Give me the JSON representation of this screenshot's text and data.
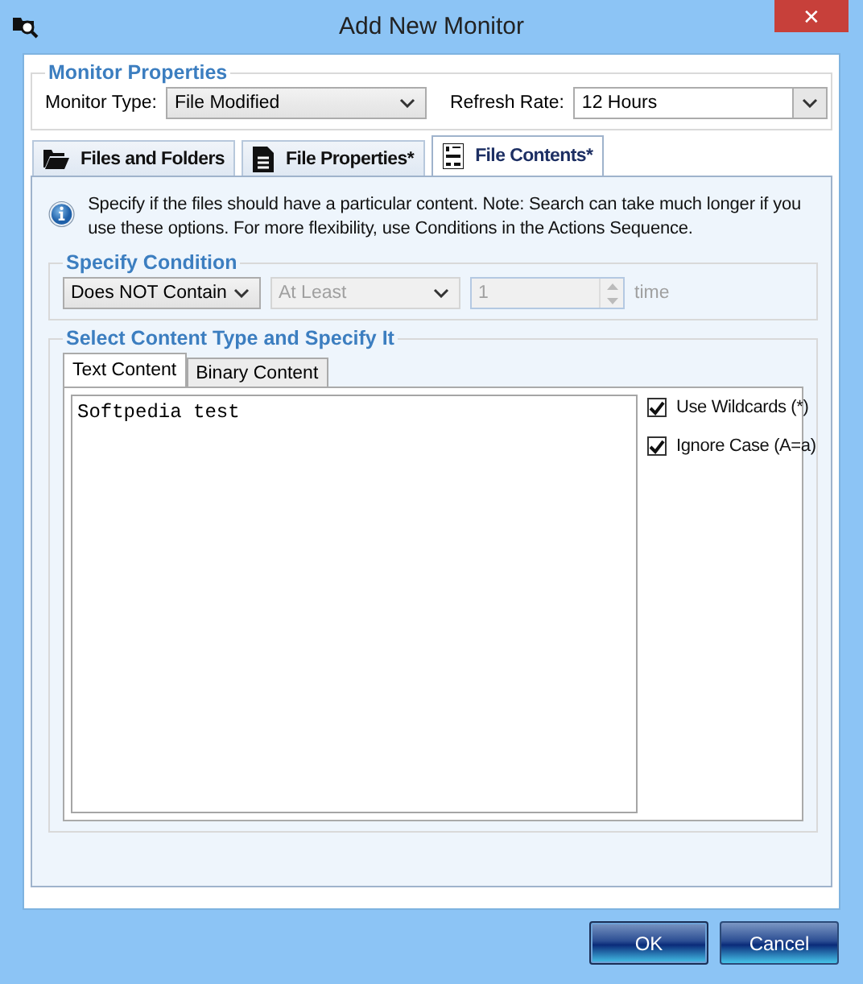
{
  "window": {
    "title": "Add New Monitor",
    "close": "✕"
  },
  "monitor_properties": {
    "title": "Monitor Properties",
    "monitor_type_label": "Monitor Type:",
    "monitor_type": "File Modified",
    "refresh_rate_label": "Refresh Rate:",
    "refresh_rate": "12 Hours"
  },
  "tabs": [
    {
      "label": "Files and Folders",
      "kind": "folder",
      "selected": false
    },
    {
      "label": "File Properties*",
      "kind": "document",
      "selected": false
    },
    {
      "label": "File Contents*",
      "kind": "binary",
      "selected": true
    }
  ],
  "info": "Specify if the files should have a particular content. Note: Search can take much longer if you use these options. For more flexibility, use Conditions in the Actions Sequence.",
  "condition": {
    "title": "Specify Condition",
    "mode": {
      "value": "Does NOT Contain",
      "disabled": false
    },
    "quantifier": {
      "value": "At Least",
      "disabled": true
    },
    "count": {
      "value": "1",
      "disabled": true
    },
    "unit": {
      "text": "time",
      "disabled": true
    }
  },
  "content": {
    "title": "Select Content Type and Specify It",
    "tabs": [
      {
        "label": "Text Content",
        "selected": true
      },
      {
        "label": "Binary Content",
        "selected": false
      }
    ],
    "text": "Softpedia test",
    "options": [
      {
        "label": "Use Wildcards (*)",
        "checked": true
      },
      {
        "label": "Ignore Case (A=a)",
        "checked": true
      }
    ]
  },
  "buttons": [
    {
      "label": "OK",
      "default": true
    },
    {
      "label": "Cancel",
      "default": false
    }
  ]
}
